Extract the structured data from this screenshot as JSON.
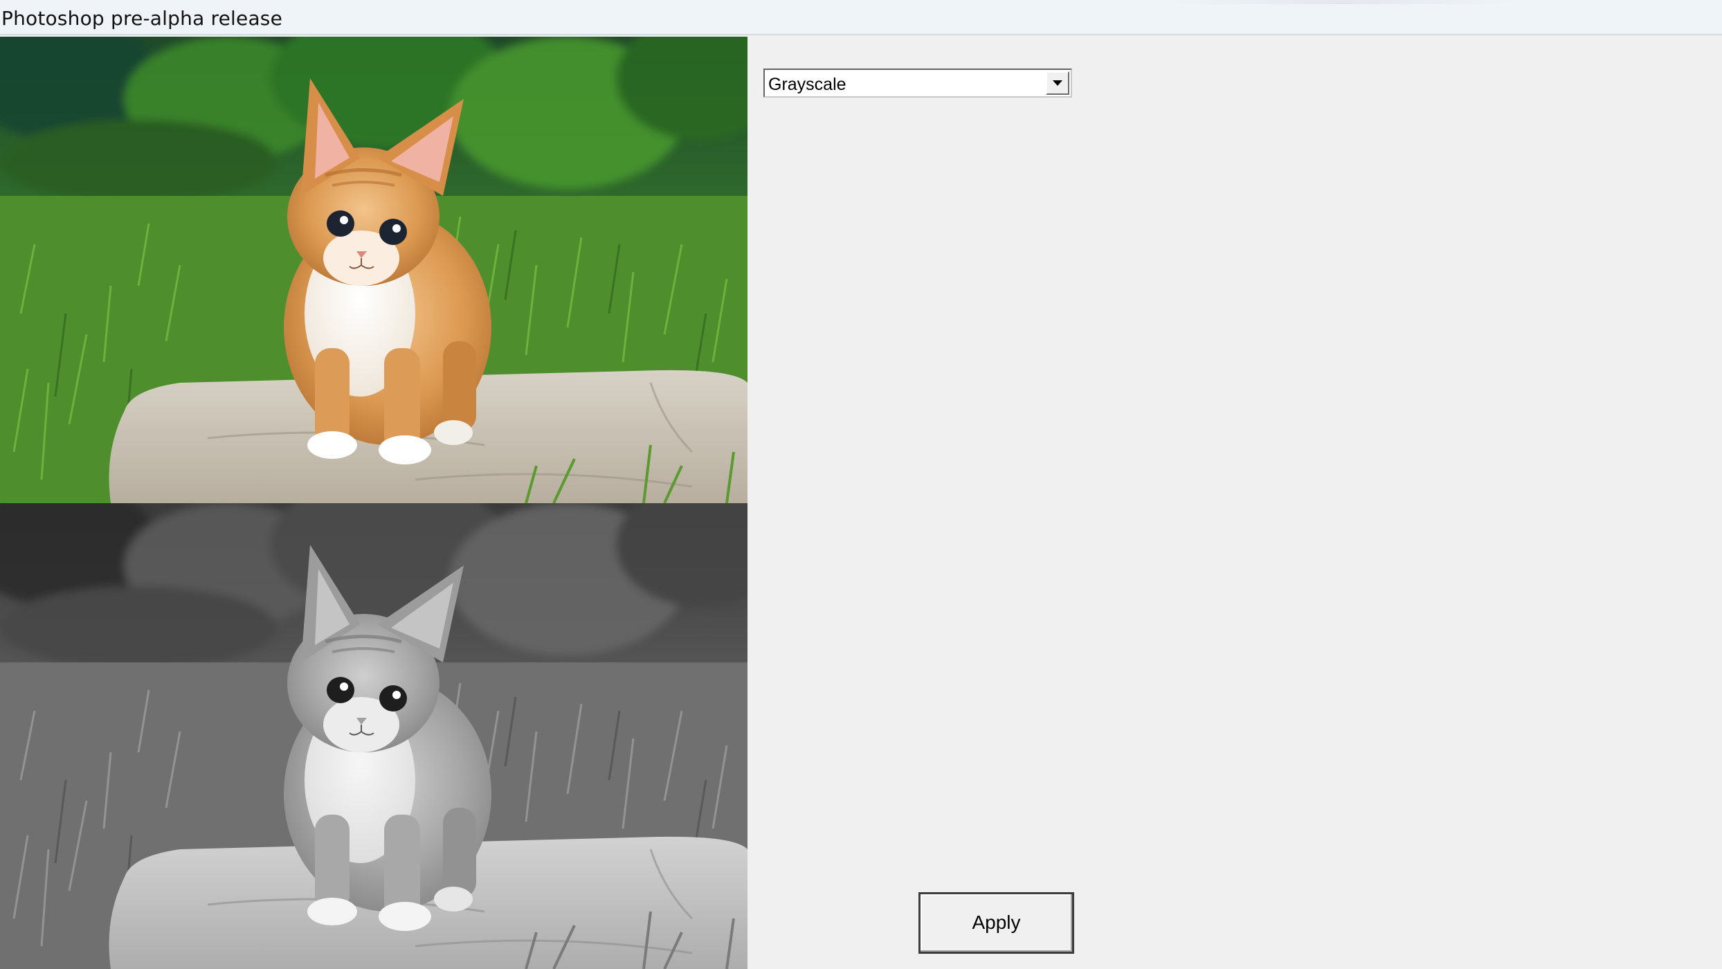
{
  "window": {
    "title": "Photoshop pre-alpha release"
  },
  "images": {
    "original": {
      "description_icon": "kitten-photo-color"
    },
    "processed": {
      "description_icon": "kitten-photo-grayscale"
    }
  },
  "controls": {
    "filter_select": {
      "selected": "Grayscale",
      "icon": "chevron-down-icon"
    },
    "apply_label": "Apply"
  },
  "colors": {
    "window_bg": "#f0f0f0",
    "titlebar_bg": "#eff4f9",
    "grass": "#4e8a2c",
    "kitten_fur": "#d9954a",
    "rock": "#c9c2b6"
  }
}
